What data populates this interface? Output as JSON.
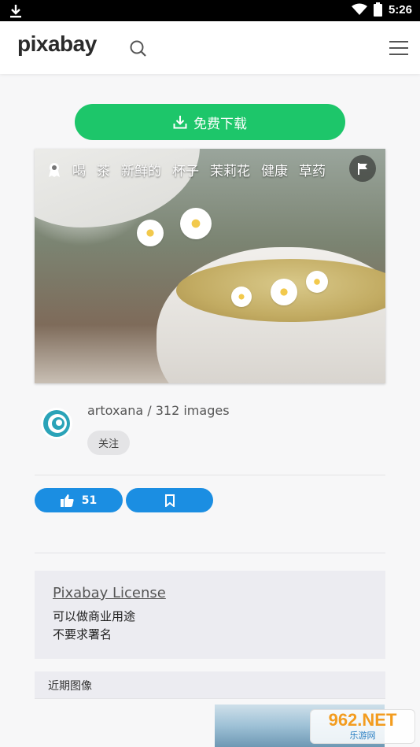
{
  "status_bar": {
    "time": "5:26"
  },
  "header": {
    "logo": "pixabay"
  },
  "download_button": {
    "label": "免费下载"
  },
  "photo": {
    "tags": [
      "喝",
      "茶",
      "新鲜的",
      "杯子",
      "茉莉花",
      "健康",
      "草药"
    ]
  },
  "author": {
    "line": "artoxana / 312 images",
    "follow_label": "关注"
  },
  "actions": {
    "like_count": "51"
  },
  "license": {
    "title": "Pixabay License",
    "lines": [
      "可以做商业用途",
      "不要求署名"
    ]
  },
  "recent": {
    "label": "近期图像"
  },
  "watermark": {
    "brand": "962.NET",
    "sub": "乐游网"
  },
  "colors": {
    "accent_green": "#1dc66a",
    "accent_blue": "#1b8ee2"
  }
}
